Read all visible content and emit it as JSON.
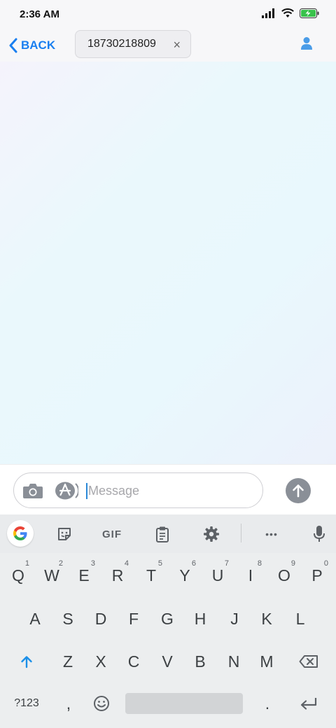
{
  "status_bar": {
    "time": "2:36 AM",
    "icons": [
      "signal-icon",
      "wifi-icon",
      "battery-charging-icon"
    ]
  },
  "nav": {
    "back_label": "BACK",
    "recipient": "18730218809",
    "chip_close_glyph": "×"
  },
  "compose": {
    "placeholder": "Message",
    "value": ""
  },
  "keyboard": {
    "toolbar": {
      "gif_label": "GIF",
      "more_glyph": "•••"
    },
    "row1": [
      {
        "key": "Q",
        "hint": "1"
      },
      {
        "key": "W",
        "hint": "2"
      },
      {
        "key": "E",
        "hint": "3"
      },
      {
        "key": "R",
        "hint": "4"
      },
      {
        "key": "T",
        "hint": "5"
      },
      {
        "key": "Y",
        "hint": "6"
      },
      {
        "key": "U",
        "hint": "7"
      },
      {
        "key": "I",
        "hint": "8"
      },
      {
        "key": "O",
        "hint": "9"
      },
      {
        "key": "P",
        "hint": "0"
      }
    ],
    "row2": [
      "A",
      "S",
      "D",
      "F",
      "G",
      "H",
      "J",
      "K",
      "L"
    ],
    "row3": [
      "Z",
      "X",
      "C",
      "V",
      "B",
      "N",
      "M"
    ],
    "row4": {
      "symbols_label": "?123",
      "comma": ",",
      "period": "."
    }
  },
  "colors": {
    "accent_blue": "#1a7ff0",
    "send_button": "#8a8f97",
    "keyboard_bg": "#eceeef"
  }
}
